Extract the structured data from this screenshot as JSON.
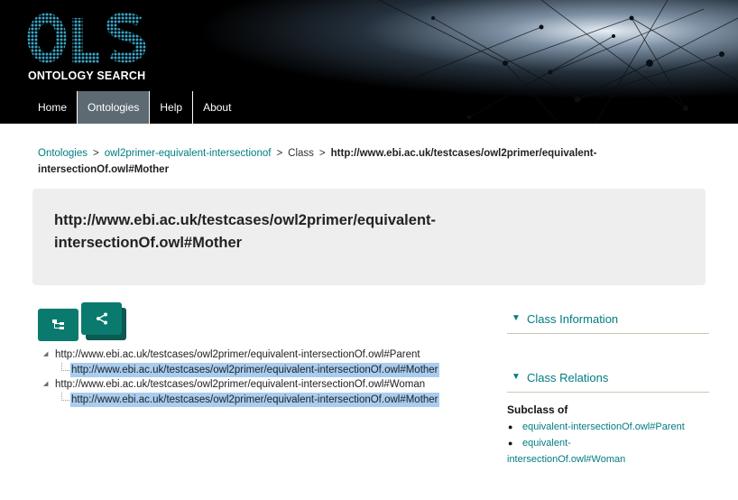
{
  "header": {
    "logo_text": "OLS",
    "logo_subtitle": "ONTOLOGY SEARCH",
    "nav": [
      {
        "label": "Home",
        "active": false
      },
      {
        "label": "Ontologies",
        "active": true
      },
      {
        "label": "Help",
        "active": false
      },
      {
        "label": "About",
        "active": false
      }
    ]
  },
  "breadcrumb": {
    "items": [
      "Ontologies",
      "owl2primer-equivalent-intersectionof",
      "Class"
    ],
    "separator": ">",
    "current": "http://www.ebi.ac.uk/testcases/owl2primer/equivalent-intersectionOf.owl#Mother"
  },
  "title": "http://www.ebi.ac.uk/testcases/owl2primer/equivalent-intersectionOf.owl#Mother",
  "tree": [
    {
      "label": "http://www.ebi.ac.uk/testcases/owl2primer/equivalent-intersectionOf.owl#Parent",
      "child": "http://www.ebi.ac.uk/testcases/owl2primer/equivalent-intersectionOf.owl#Mother"
    },
    {
      "label": "http://www.ebi.ac.uk/testcases/owl2primer/equivalent-intersectionOf.owl#Woman",
      "child": "http://www.ebi.ac.uk/testcases/owl2primer/equivalent-intersectionOf.owl#Mother"
    }
  ],
  "sidebar": {
    "class_information": "Class Information",
    "class_relations": "Class Relations",
    "subclass_of": "Subclass of",
    "subclass_items": [
      "equivalent-intersectionOf.owl#Parent",
      "equivalent-intersectionOf.owl#Woman"
    ],
    "subclass_item2_line1": "equivalent-",
    "subclass_item2_line2": "intersectionOf.owl#Woman"
  },
  "colors": {
    "accent": "#007c82",
    "button": "#0a7a6e",
    "nav_active": "#5d6a72",
    "selection": "#a8cdf0"
  },
  "icons": {
    "tree_button": "hierarchy-icon",
    "share_button": "share-icon",
    "expanded": "triangle-down-icon"
  }
}
